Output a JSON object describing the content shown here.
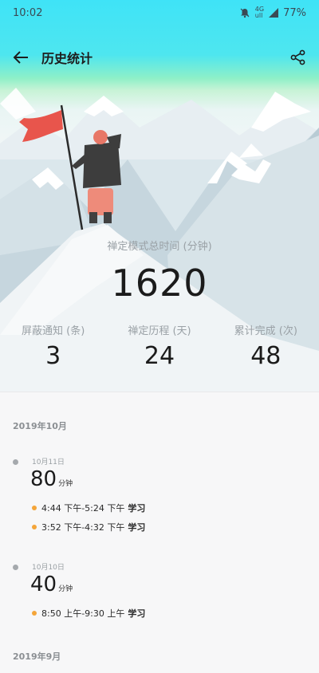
{
  "status_bar": {
    "time": "10:02",
    "battery": "77%",
    "signal_small_top": "4G",
    "signal_small_bottom": "ull"
  },
  "header": {
    "title": "历史统计"
  },
  "summary": {
    "total_label": "禅定模式总时间 (分钟)",
    "total_value": "1620",
    "stats": [
      {
        "label": "屏蔽通知 (条)",
        "value": "3"
      },
      {
        "label": "禅定历程 (天)",
        "value": "24"
      },
      {
        "label": "累计完成 (次)",
        "value": "48"
      }
    ]
  },
  "history": {
    "months": [
      {
        "label": "2019年10月",
        "days": [
          {
            "date": "10月11日",
            "minutes": "80",
            "unit": "分钟",
            "sessions": [
              {
                "time": "4:44 下午-5:24 下午",
                "tag": "学习"
              },
              {
                "time": "3:52 下午-4:32 下午",
                "tag": "学习"
              }
            ]
          },
          {
            "date": "10月10日",
            "minutes": "40",
            "unit": "分钟",
            "sessions": [
              {
                "time": "8:50 上午-9:30 上午",
                "tag": "学习"
              }
            ]
          }
        ]
      },
      {
        "label": "2019年9月",
        "days": []
      }
    ]
  },
  "colors": {
    "accent_dot": "#f4a53a",
    "timeline_dot": "#a5a9ad",
    "flag": "#e8554c"
  }
}
